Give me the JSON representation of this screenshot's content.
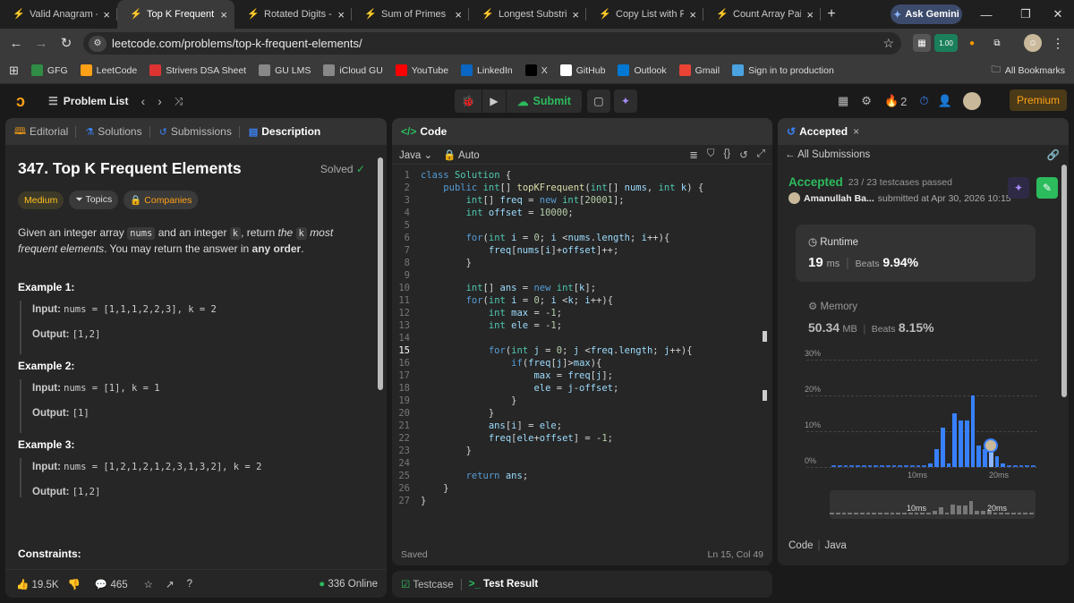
{
  "browser": {
    "tabs": [
      {
        "label": "Valid Anagram - Le",
        "active": false
      },
      {
        "label": "Top K Frequent Ele",
        "active": true
      },
      {
        "label": "Rotated Digits - Le",
        "active": false
      },
      {
        "label": "Sum of Primes Be",
        "active": false
      },
      {
        "label": "Longest Substring",
        "active": false
      },
      {
        "label": "Copy List with Ran",
        "active": false
      },
      {
        "label": "Count Array Pairs",
        "active": false
      }
    ],
    "new_tab": "+",
    "ask_gemini": "Ask Gemini",
    "url": "leetcode.com/problems/top-k-frequent-elements/",
    "extension_badge": "1.00",
    "bookmarks": [
      {
        "label": "GFG",
        "icon": "gfg-icon",
        "color": "#2f8d46"
      },
      {
        "label": "LeetCode",
        "icon": "leetcode-icon",
        "color": "#ffa116"
      },
      {
        "label": "Strivers DSA Sheet",
        "icon": "tuf-icon",
        "color": "#d33"
      },
      {
        "label": "GU LMS",
        "icon": "gu-lms-icon",
        "color": "#888"
      },
      {
        "label": "iCloud GU",
        "icon": "icloud-icon",
        "color": "#888"
      },
      {
        "label": "YouTube",
        "icon": "youtube-icon",
        "color": "#f00"
      },
      {
        "label": "LinkedIn",
        "icon": "linkedin-icon",
        "color": "#0a66c2"
      },
      {
        "label": "X",
        "icon": "x-icon",
        "color": "#000"
      },
      {
        "label": "GitHub",
        "icon": "github-icon",
        "color": "#fff"
      },
      {
        "label": "Outlook",
        "icon": "outlook-icon",
        "color": "#0078d4"
      },
      {
        "label": "Gmail",
        "icon": "gmail-icon",
        "color": "#ea4335"
      },
      {
        "label": "Sign in to production",
        "icon": "production-icon",
        "color": "#4aa3df"
      }
    ],
    "all_bookmarks": "All Bookmarks"
  },
  "header": {
    "problem_list": "Problem List",
    "submit": "Submit",
    "streak_count": "2",
    "premium": "Premium"
  },
  "left": {
    "tabs": {
      "editorial": "Editorial",
      "solutions": "Solutions",
      "submissions": "Submissions",
      "description": "Description"
    },
    "title": "347. Top K Frequent Elements",
    "solved": "Solved",
    "difficulty": "Medium",
    "topics": "Topics",
    "companies": "Companies",
    "desc_1": "Given an integer array",
    "desc_nums": "nums",
    "desc_2": "and an integer",
    "desc_k": "k",
    "desc_3": ", return",
    "desc_the": "the",
    "desc_k2": "k",
    "desc_4": "most frequent",
    "desc_5": "elements",
    "desc_6": ". You may return the answer in",
    "desc_any": "any order",
    "desc_dot": ".",
    "examples": [
      {
        "title": "Example 1:",
        "input_label": "Input:",
        "input": "nums = [1,1,1,2,2,3], k = 2",
        "output_label": "Output:",
        "output": "[1,2]"
      },
      {
        "title": "Example 2:",
        "input_label": "Input:",
        "input": "nums = [1], k = 1",
        "output_label": "Output:",
        "output": "[1]"
      },
      {
        "title": "Example 3:",
        "input_label": "Input:",
        "input": "nums = [1,2,1,2,1,2,3,1,3,2], k = 2",
        "output_label": "Output:",
        "output": "[1,2]"
      }
    ],
    "constraints": "Constraints:",
    "likes": "19.5K",
    "comments": "465",
    "online": "336 Online"
  },
  "code": {
    "title": "Code",
    "language": "Java",
    "auto": "Auto",
    "status": "Saved",
    "cursor": "Ln 15, Col 49",
    "testcase": "Testcase",
    "test_result": "Test Result",
    "lines": [
      "class Solution {",
      "    public int[] topKFrequent(int[] nums, int k) {",
      "        int[] freq = new int[20001];",
      "        int offset = 10000;",
      "",
      "        for(int i = 0; i <nums.length; i++){",
      "            freq[nums[i]+offset]++;",
      "        }",
      "",
      "        int[] ans = new int[k];",
      "        for(int i = 0; i <k; i++){",
      "            int max = -1;",
      "            int ele = -1;",
      "",
      "            for(int j = 0; j <freq.length; j++){",
      "                if(freq[j]>max){",
      "                    max = freq[j];",
      "                    ele = j-offset;",
      "                }",
      "            }",
      "            ans[i] = ele;",
      "            freq[ele+offset] = -1;",
      "        }",
      "",
      "        return ans;",
      "    }",
      "}"
    ]
  },
  "result": {
    "tab": "Accepted",
    "all_submissions": "All Submissions",
    "status": "Accepted",
    "testcases": "23 / 23 testcases passed",
    "user": "Amanullah Ba...",
    "submitted_at": "submitted at Apr 30, 2026 10:15",
    "runtime_label": "Runtime",
    "runtime_value": "19",
    "runtime_unit": "ms",
    "beats_label": "Beats",
    "runtime_beats": "9.94%",
    "memory_label": "Memory",
    "memory_value": "50.34",
    "memory_unit": "MB",
    "memory_beats": "8.15%",
    "code_label": "Code",
    "code_lang": "Java",
    "colors": {
      "accent": "#2cbb5d",
      "bar": "#3880ff"
    }
  },
  "chart_data": {
    "type": "bar",
    "y_ticks": [
      "30%",
      "20%",
      "10%",
      "0%"
    ],
    "x_ticks": [
      "10ms",
      "20ms"
    ],
    "ylim": [
      0,
      30
    ],
    "values": [
      0.5,
      0.5,
      0.5,
      0.5,
      0.5,
      0.5,
      0.5,
      0.5,
      0.5,
      0.5,
      0.5,
      0.5,
      0.5,
      0.5,
      0.5,
      0.5,
      1,
      5,
      11,
      1,
      15,
      13,
      13,
      20,
      6,
      5,
      5,
      3,
      1,
      0.5,
      0.5,
      0.5,
      0.5,
      0.5
    ],
    "highlight_index": 26
  }
}
